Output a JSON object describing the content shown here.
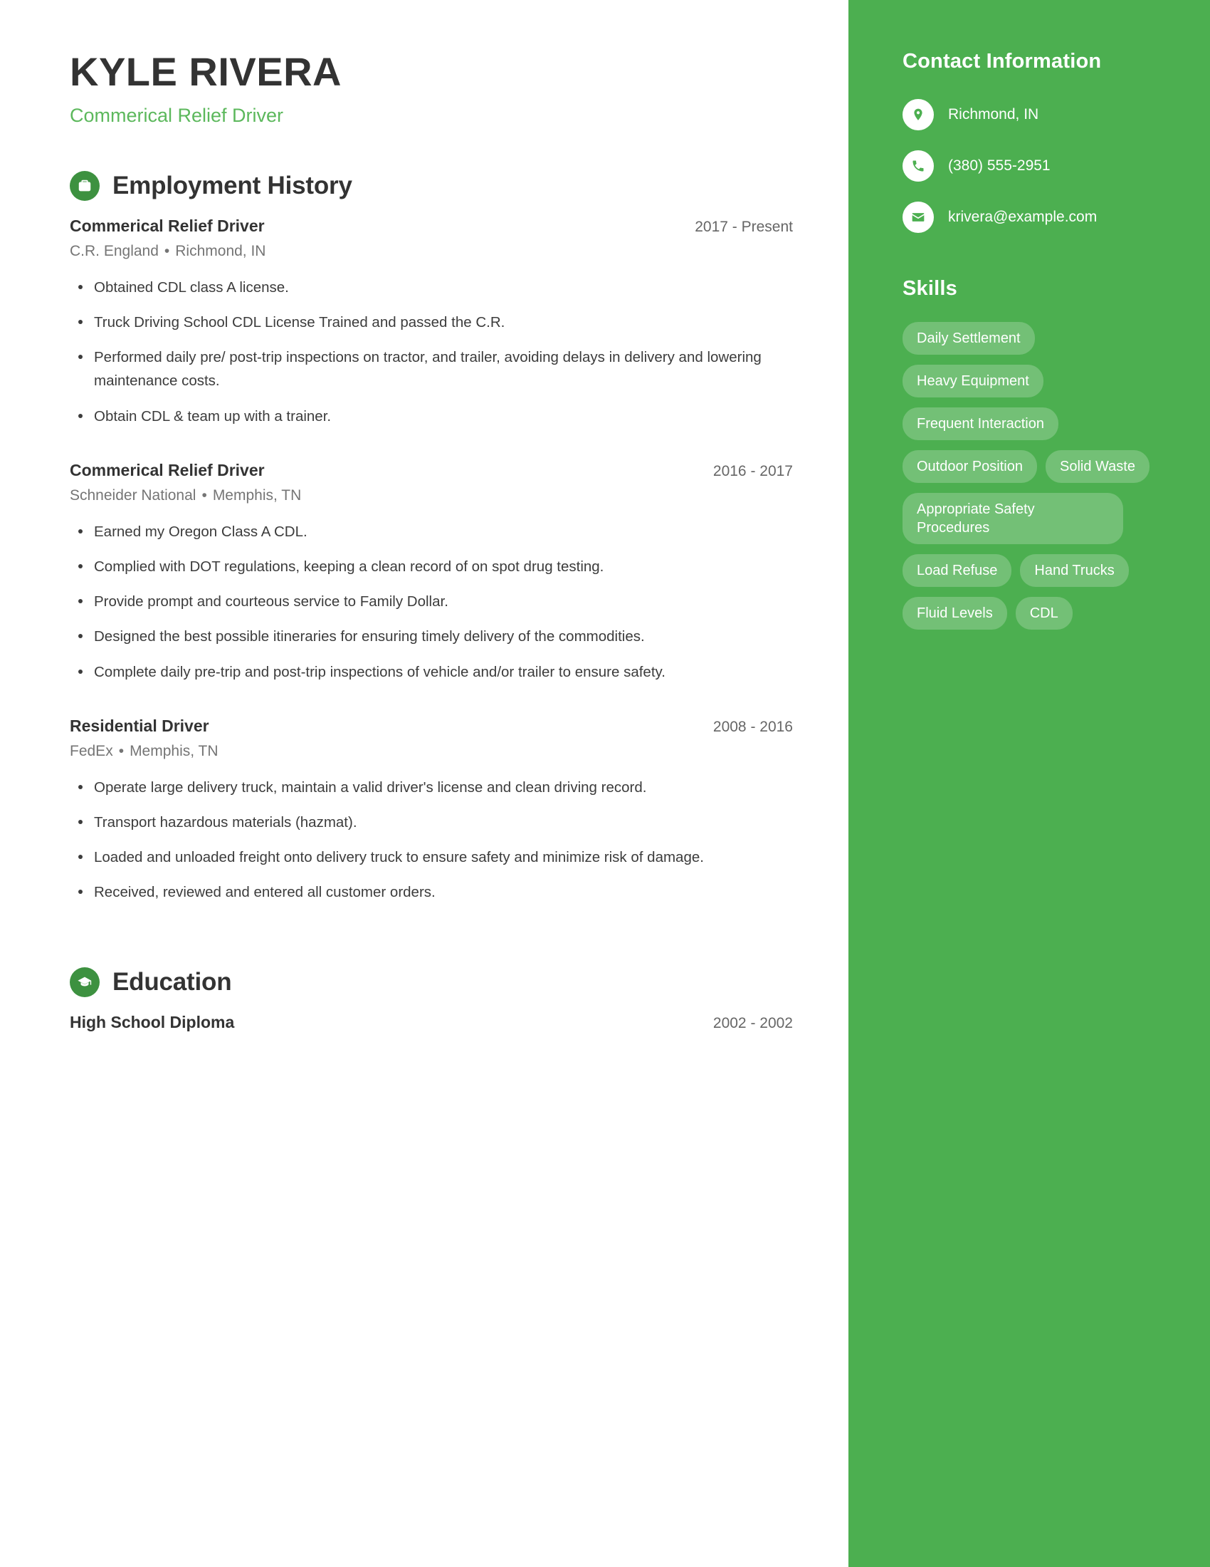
{
  "header": {
    "name": "KYLE RIVERA",
    "title": "Commerical Relief Driver"
  },
  "sections": {
    "employment": {
      "heading": "Employment History",
      "icon": "briefcase-icon"
    },
    "education": {
      "heading": "Education",
      "icon": "graduation-cap-icon"
    }
  },
  "employment": [
    {
      "title": "Commerical Relief Driver",
      "date": "2017 - Present",
      "company": "C.R. England",
      "location": "Richmond, IN",
      "separator": "•",
      "bullets": [
        "Obtained CDL class A license.",
        "Truck Driving School CDL License Trained and passed the C.R.",
        "Performed daily pre/ post-trip inspections on tractor, and trailer, avoiding delays in delivery and lowering maintenance costs.",
        "Obtain CDL & team up with a trainer."
      ]
    },
    {
      "title": "Commerical Relief Driver",
      "date": "2016 - 2017",
      "company": "Schneider National",
      "location": "Memphis, TN",
      "separator": "•",
      "bullets": [
        "Earned my Oregon Class A CDL.",
        "Complied with DOT regulations, keeping a clean record of on spot drug testing.",
        "Provide prompt and courteous service to Family Dollar.",
        "Designed the best possible itineraries for ensuring timely delivery of the commodities.",
        "Complete daily pre-trip and post-trip inspections of vehicle and/or trailer to ensure safety."
      ]
    },
    {
      "title": "Residential Driver",
      "date": "2008 - 2016",
      "company": "FedEx",
      "location": "Memphis, TN",
      "separator": "•",
      "bullets": [
        "Operate large delivery truck, maintain a valid driver's license and clean driving record.",
        "Transport hazardous materials (hazmat).",
        "Loaded and unloaded freight onto delivery truck to ensure safety and minimize risk of damage.",
        "Received, reviewed and entered all customer orders."
      ]
    }
  ],
  "education": [
    {
      "title": "High School Diploma",
      "date": "2002 - 2002"
    }
  ],
  "sidebar": {
    "contact_heading": "Contact Information",
    "contact": [
      {
        "icon": "location-pin-icon",
        "value": "Richmond, IN"
      },
      {
        "icon": "phone-icon",
        "value": "(380) 555-2951"
      },
      {
        "icon": "envelope-icon",
        "value": "krivera@example.com"
      }
    ],
    "skills_heading": "Skills",
    "skills": [
      "Daily Settlement",
      "Heavy Equipment",
      "Frequent Interaction",
      "Outdoor Position",
      "Solid Waste",
      "Appropriate Safety Procedures",
      "Load Refuse",
      "Hand Trucks",
      "Fluid Levels",
      "CDL"
    ]
  },
  "colors": {
    "sidebar_green": "#4CAF50",
    "icon_green": "#3D9140",
    "accent_green": "#5CB85C",
    "heading_dark": "#333333",
    "body_text": "#3C3C3C",
    "muted_text": "#757575",
    "pill_bg": "rgba(255,255,255,0.22)"
  }
}
